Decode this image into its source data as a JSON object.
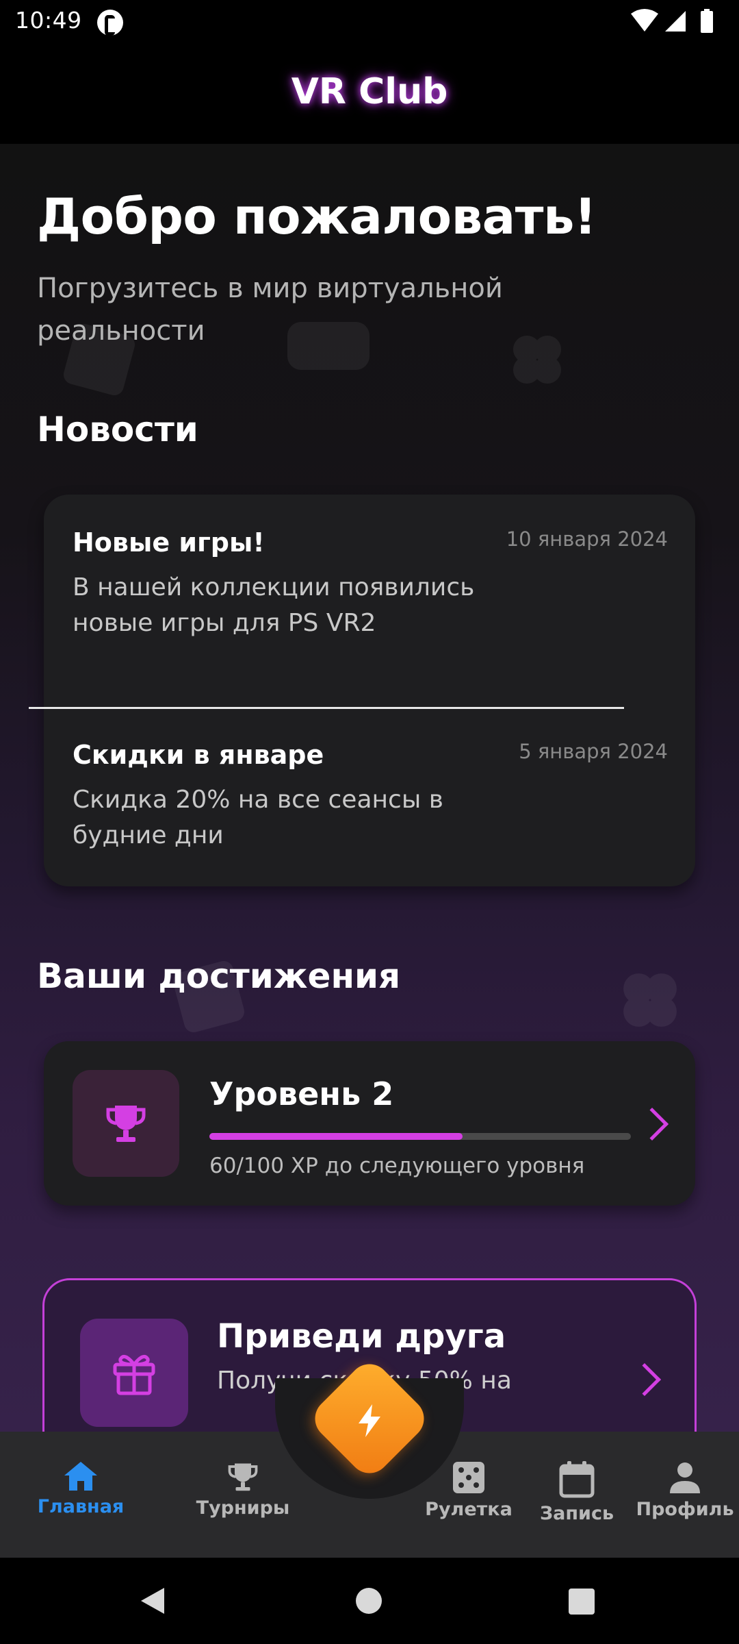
{
  "status_bar": {
    "time": "10:49"
  },
  "app_bar": {
    "title": "VR Club"
  },
  "welcome": {
    "title": "Добро пожаловать!",
    "subtitle": "Погрузитесь в мир виртуальной реальности"
  },
  "news": {
    "section_title": "Новости",
    "items": [
      {
        "title": "Новые игры!",
        "date": "10 января 2024",
        "body": "В нашей коллекции появились новые игры для PS VR2"
      },
      {
        "title": "Скидки в январе",
        "date": "5 января 2024",
        "body": "Скидка 20% на все сеансы в будние дни"
      }
    ]
  },
  "achievements": {
    "section_title": "Ваши достижения",
    "level": "Уровень 2",
    "progress_fraction": 0.6,
    "xp_text": "60/100 XP до следующего уровня"
  },
  "referral": {
    "title": "Приведи друга",
    "subtitle": "Получи скидку 50% на"
  },
  "bottom_nav": {
    "items": [
      {
        "label": "Главная",
        "icon": "home-icon",
        "active": true
      },
      {
        "label": "Турниры",
        "icon": "trophy-icon",
        "active": false
      },
      {
        "label": "Рулетка",
        "icon": "dice-icon",
        "active": false
      },
      {
        "label": "Запись",
        "icon": "calendar-icon",
        "active": false
      },
      {
        "label": "Профиль",
        "icon": "person-icon",
        "active": false
      }
    ],
    "center_action_icon": "lightning-icon"
  },
  "colors": {
    "accent": "#d43fe3",
    "active_nav": "#2b8ff0",
    "fab": "#f5901e",
    "card_bg": "#1e1e20"
  }
}
